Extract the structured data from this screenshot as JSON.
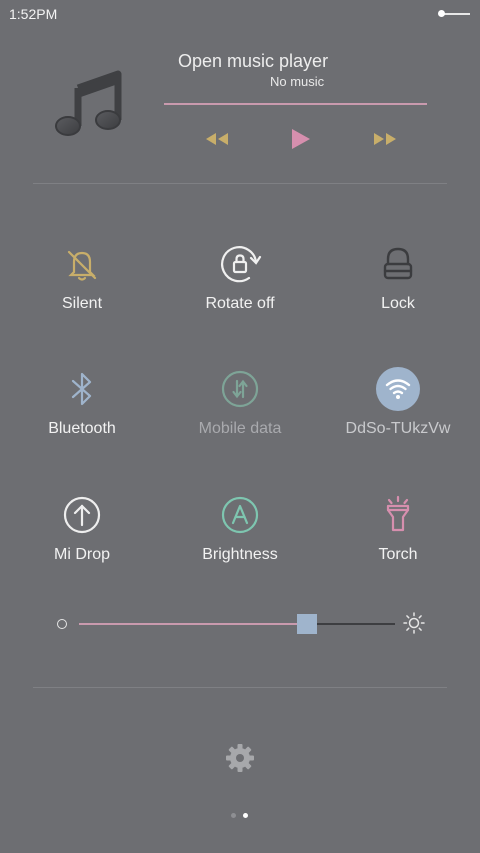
{
  "status_bar": {
    "time": "1:52PM"
  },
  "music": {
    "title": "Open music player",
    "subtitle": "No music",
    "icon": "music-note-icon",
    "controls": [
      "rewind-icon",
      "play-icon",
      "fast-forward-icon"
    ]
  },
  "toggles": [
    {
      "label": "Silent",
      "icon": "bell-off-icon",
      "color": "#c8ae6a",
      "active": false
    },
    {
      "label": "Rotate off",
      "icon": "rotate-lock-icon",
      "color": "#f0f0f0",
      "active": false
    },
    {
      "label": "Lock",
      "icon": "lock-icon",
      "color": "#3b3c3f",
      "active": false
    },
    {
      "label": "Bluetooth",
      "icon": "bluetooth-icon",
      "color": "#9fb4cc",
      "active": false
    },
    {
      "label": "Mobile data",
      "icon": "mobile-data-icon",
      "color": "#7ea497",
      "active": false
    },
    {
      "label": "DdSo-TUkzVw",
      "icon": "wifi-icon",
      "color": "#9fb4cc",
      "active": true
    },
    {
      "label": "Mi Drop",
      "icon": "upload-icon",
      "color": "#eeeeee",
      "active": false
    },
    {
      "label": "Brightness",
      "icon": "auto-brightness-icon",
      "color": "#7ec6b0",
      "active": false
    },
    {
      "label": "Torch",
      "icon": "flashlight-icon",
      "color": "#d68fae",
      "active": false
    }
  ],
  "brightness": {
    "level": 0.72,
    "min_icon": "brightness-low-icon",
    "max_icon": "brightness-high-icon"
  },
  "footer": {
    "settings_icon": "gear-icon",
    "page_count": 2,
    "current_page": 2
  },
  "colors": {
    "background": "#6d6e72",
    "accent_pink": "#c99aae",
    "accent_gold": "#c8ae6a",
    "accent_blue": "#9fb4cc"
  }
}
